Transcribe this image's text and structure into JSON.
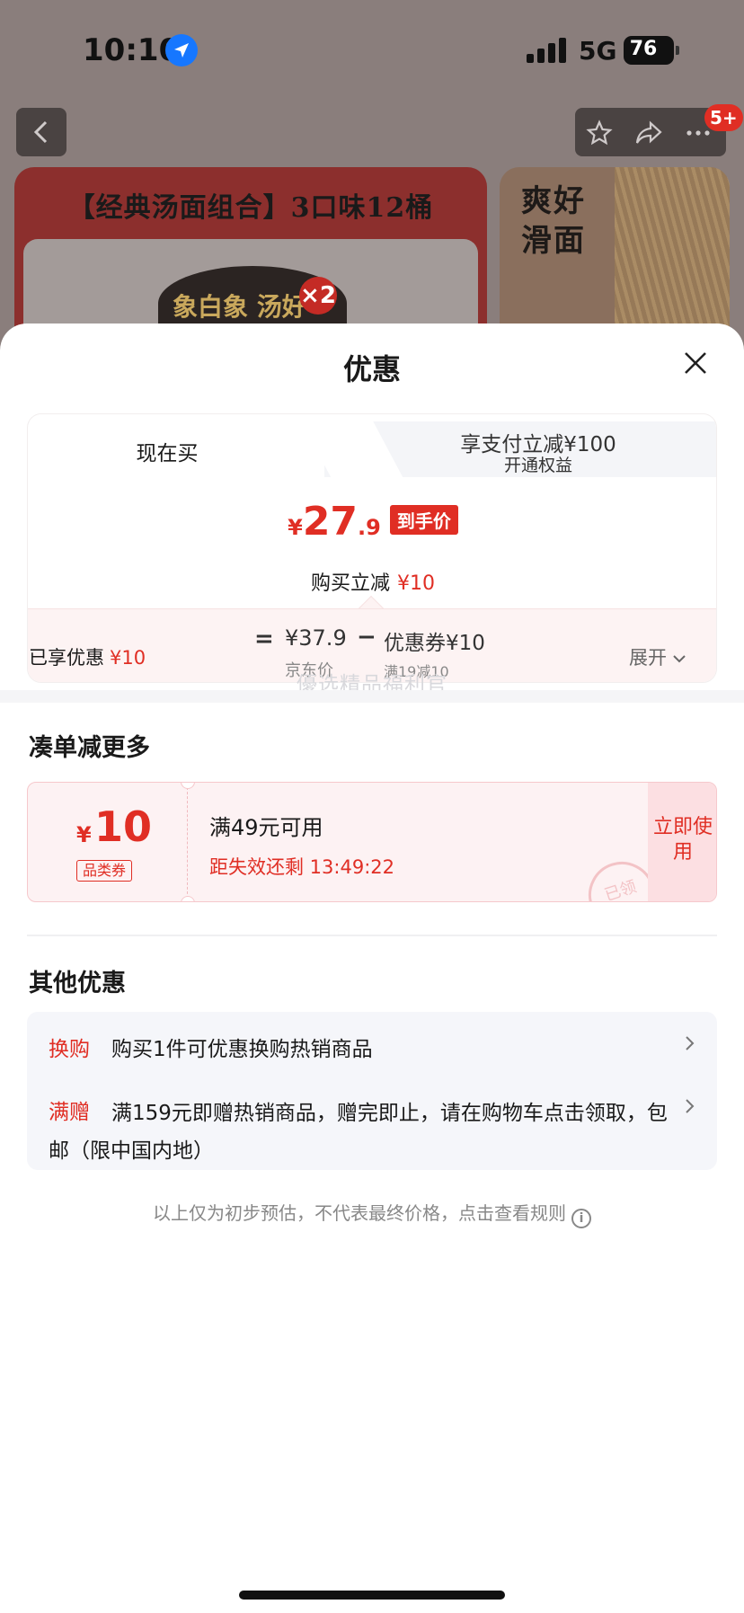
{
  "status_bar": {
    "time": "10:10",
    "network": "5G",
    "battery": "76"
  },
  "nav": {
    "badge": "5+"
  },
  "background_cards": {
    "left_title": "【经典汤面组合】3口味12桶",
    "cup_text": "象白象 汤好",
    "cup_badge": "×2",
    "right_text": "爽好滑面"
  },
  "sheet": {
    "title": "优惠",
    "tabs": [
      {
        "label": "现在买"
      },
      {
        "label": "享支付立减¥100",
        "sub": "开通权益"
      }
    ],
    "price": {
      "yen": "¥",
      "integer": "27",
      "decimal": ".9",
      "tag": "到手价",
      "instant_label": "购买立减",
      "instant_value": "¥10"
    },
    "calc": {
      "equals": "=",
      "jd_price": "¥37.9",
      "minus": "−",
      "coupon": "优惠券¥10",
      "jd_label": "京东价",
      "coupon_label": "满19减10"
    },
    "enjoyed_label": "已享优惠",
    "enjoyed_value": "¥10",
    "expand_label": "展开",
    "watermark": "優选精品福利官"
  },
  "more_section": {
    "title": "凑单减更多",
    "coupon": {
      "yen": "¥",
      "amount": "10",
      "type": "品类券",
      "condition": "满49元可用",
      "timer": "距失效还剩 13:49:22",
      "stamp": "已领",
      "use_label": "立即使用"
    }
  },
  "other_section": {
    "title": "其他优惠",
    "items": [
      {
        "tag": "换购",
        "text": "购买1件可优惠换购热销商品"
      },
      {
        "tag": "满赠",
        "text": "满159元即赠热销商品，赠完即止，请在购物车点击领取，包邮（限中国内地）"
      }
    ]
  },
  "disclaimer": "以上仅为初步预估，不代表最终价格，点击查看规则",
  "colors": {
    "accent": "#e02e24",
    "coupon_bg": "#fdf2f3",
    "panel_bg": "#f5f6fa"
  }
}
